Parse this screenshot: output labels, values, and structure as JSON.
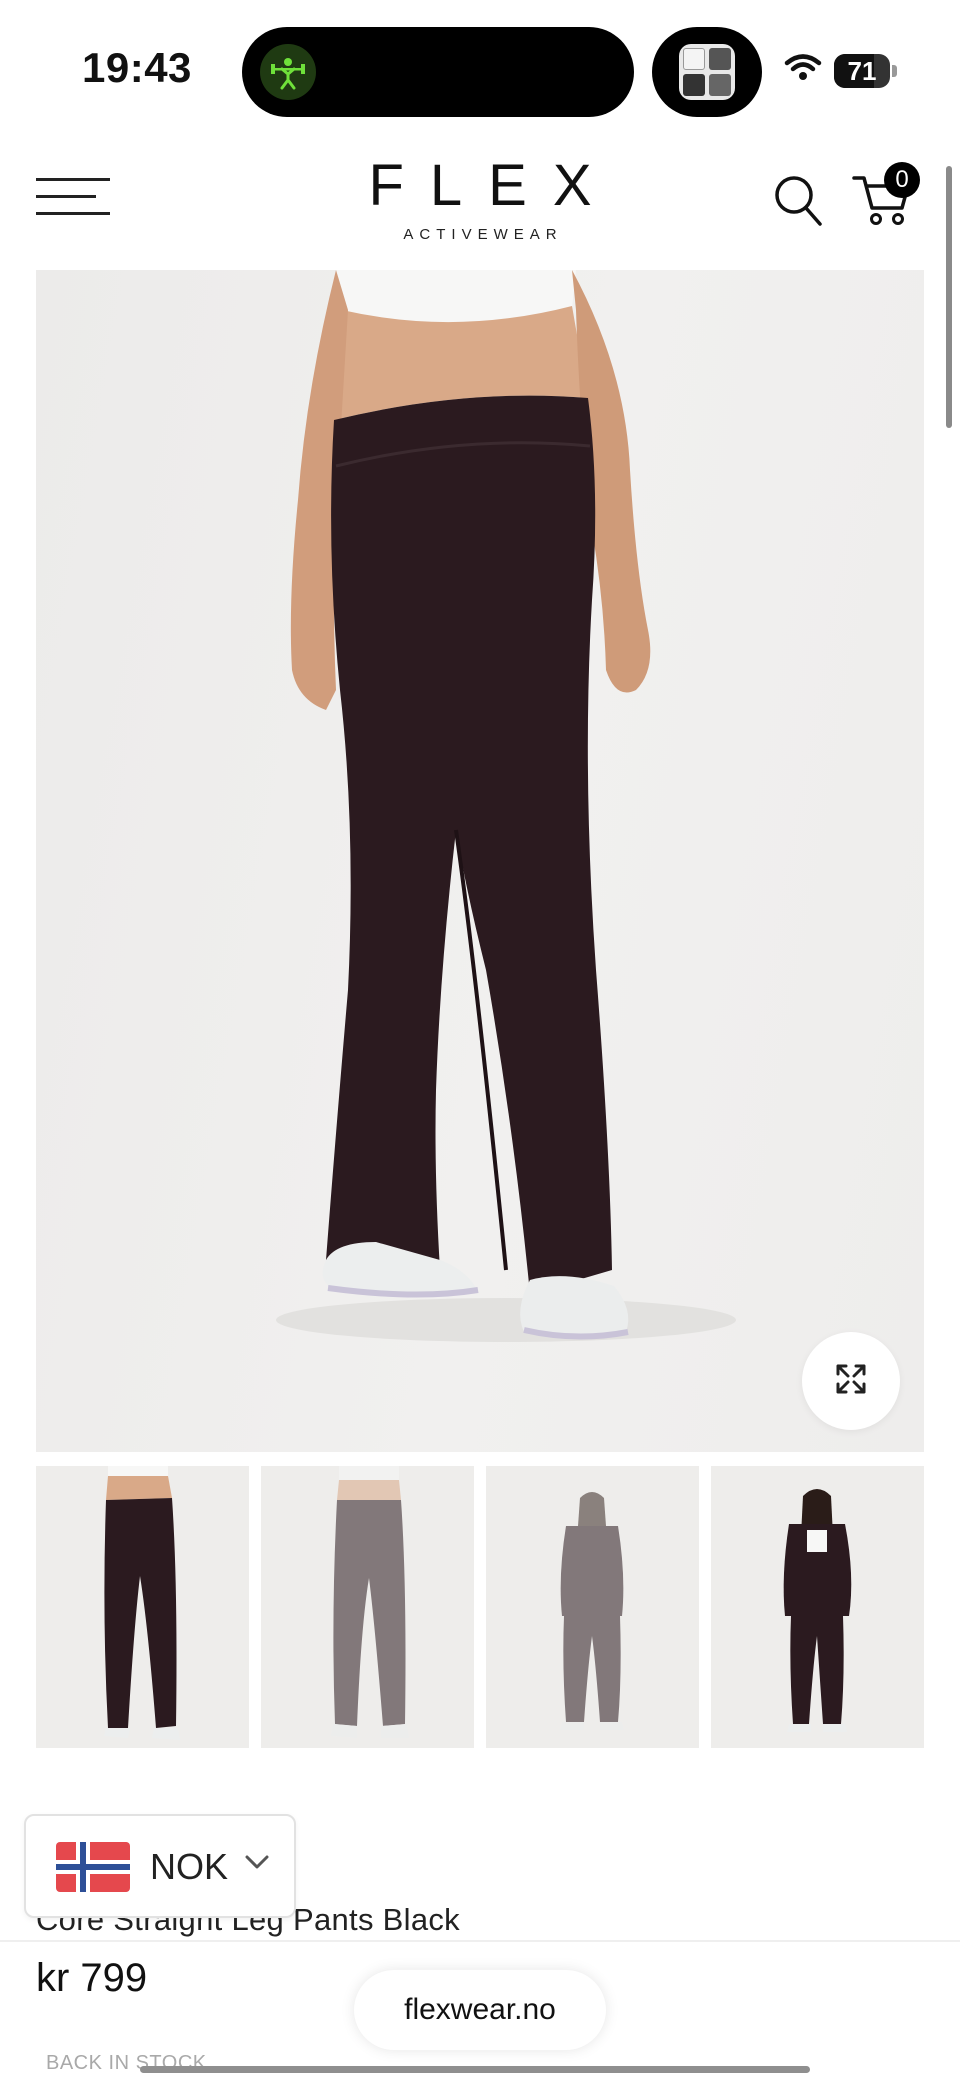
{
  "status_bar": {
    "time": "19:43",
    "battery_level": "71",
    "battery_fraction": 0.71,
    "live_activity_icon": "weightlifter-icon",
    "media_icon": "album-art-icon"
  },
  "header": {
    "logo_main": "FLEX",
    "logo_sub": "ACTIVEWEAR",
    "cart_count": "0",
    "menu_icon": "hamburger-icon",
    "search_icon": "search-icon",
    "cart_icon": "cart-icon"
  },
  "gallery": {
    "zoom_icon": "expand-icon",
    "thumbnail_count": 4,
    "thumbnails": [
      "front-view",
      "back-view",
      "full-outfit-front",
      "full-outfit-jacket-open"
    ]
  },
  "currency": {
    "code": "NOK",
    "flag": "norway-flag-icon"
  },
  "product": {
    "title": "Core Straight Leg Pants Black",
    "price": "kr 799",
    "stock_status": "BACK IN STOCK"
  },
  "browser": {
    "url": "flexwear.no"
  },
  "colors": {
    "brand": "#111111",
    "background": "#ffffff",
    "image_background": "#eeedec",
    "pants": "#2b1a1f",
    "live_activity": "#6fe13a"
  }
}
